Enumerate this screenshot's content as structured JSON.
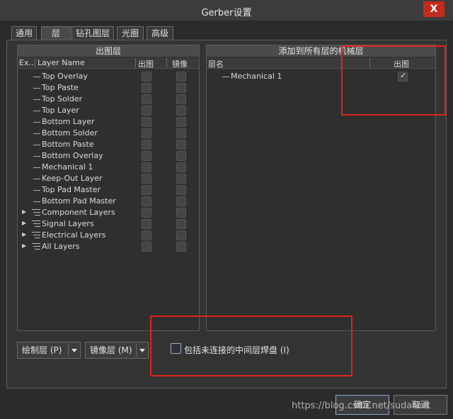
{
  "window": {
    "title": "Gerber设置",
    "close_label": "X"
  },
  "tabs": [
    {
      "label": "通用"
    },
    {
      "label": "层"
    },
    {
      "label": "钻孔图层"
    },
    {
      "label": "光圈"
    },
    {
      "label": "高级"
    }
  ],
  "plot_layers": {
    "header": "出图层",
    "columns": {
      "expand": "Ex...",
      "name": "Layer Name",
      "plot": "出图",
      "mirror": "镜像"
    },
    "items": [
      {
        "label": "Top Overlay",
        "kind": "layer"
      },
      {
        "label": "Top Paste",
        "kind": "layer"
      },
      {
        "label": "Top Solder",
        "kind": "layer"
      },
      {
        "label": "Top Layer",
        "kind": "layer"
      },
      {
        "label": "Bottom Layer",
        "kind": "layer"
      },
      {
        "label": "Bottom Solder",
        "kind": "layer"
      },
      {
        "label": "Bottom Paste",
        "kind": "layer"
      },
      {
        "label": "Bottom Overlay",
        "kind": "layer"
      },
      {
        "label": "Mechanical 1",
        "kind": "layer"
      },
      {
        "label": "Keep-Out Layer",
        "kind": "layer"
      },
      {
        "label": "Top Pad Master",
        "kind": "layer"
      },
      {
        "label": "Bottom Pad Master",
        "kind": "layer"
      },
      {
        "label": "Component Layers",
        "kind": "group"
      },
      {
        "label": "Signal Layers",
        "kind": "group"
      },
      {
        "label": "Electrical Layers",
        "kind": "group"
      },
      {
        "label": "All Layers",
        "kind": "group"
      }
    ]
  },
  "mechanical": {
    "header": "添加到所有层的机械层",
    "columns": {
      "name": "层名",
      "plot": "出图"
    },
    "items": [
      {
        "label": "Mechanical 1",
        "checked": true
      }
    ]
  },
  "buttons": {
    "plot_layers": "绘制层 (P)",
    "mirror_layers": "镜像层 (M)",
    "ok": "确定",
    "cancel": "取消"
  },
  "include_checkbox": {
    "label": "包括未连接的中间层焊盘 (I)",
    "checked": false
  },
  "watermark": "https://blog.csdn.net/sudaroot",
  "colors": {
    "highlight": "#e0231a",
    "close": "#c42b1c"
  }
}
